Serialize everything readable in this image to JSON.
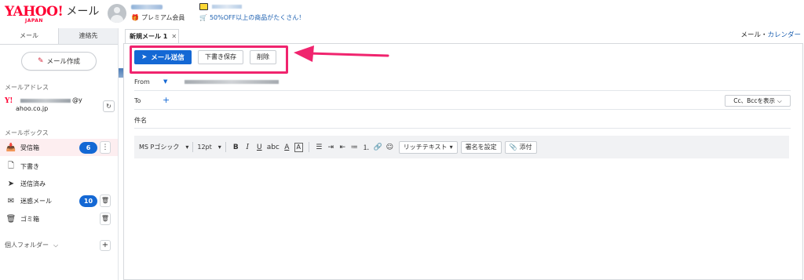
{
  "header": {
    "logo_main": "YAHOO!",
    "logo_sub": "JAPAN",
    "logo_mail": "メール",
    "premium_label": "プレミアム会員",
    "promo_text": "50%OFF以上の商品がたくさん！"
  },
  "sidebar": {
    "tabs": [
      "メール",
      "連絡先"
    ],
    "compose_label": "メール作成",
    "address_section": "メールアドレス",
    "address_tail": "@y",
    "address_domain": "ahoo.co.jp",
    "mailbox_section": "メールボックス",
    "mailboxes": [
      {
        "label": "受信箱",
        "icon": "inbox-icon",
        "badge": "6"
      },
      {
        "label": "下書き",
        "icon": "draft-icon"
      },
      {
        "label": "送信済み",
        "icon": "sent-icon"
      },
      {
        "label": "迷惑メール",
        "icon": "spam-icon",
        "badge": "10"
      },
      {
        "label": "ゴミ箱",
        "icon": "trash-icon"
      }
    ],
    "folders_label": "個人フォルダー"
  },
  "compose_tab": {
    "title": "新規メール 1"
  },
  "breadcrumb": {
    "current": "メール",
    "separator": "・",
    "link": "カレンダー"
  },
  "toolbar": {
    "send_label": "メール送信",
    "draft_label": "下書き保存",
    "delete_label": "削除"
  },
  "fields": {
    "from_label": "From",
    "to_label": "To",
    "cc_label": "Cc、Bccを表示",
    "subject_label": "件名"
  },
  "format_bar": {
    "font": "MS Pゴシック",
    "size": "12pt",
    "richtext": "リッチテキスト",
    "signature": "署名を設定",
    "attach": "添付"
  },
  "colors": {
    "accent": "#1468d4",
    "highlight": "#f0246e",
    "brand": "#ff0033"
  }
}
